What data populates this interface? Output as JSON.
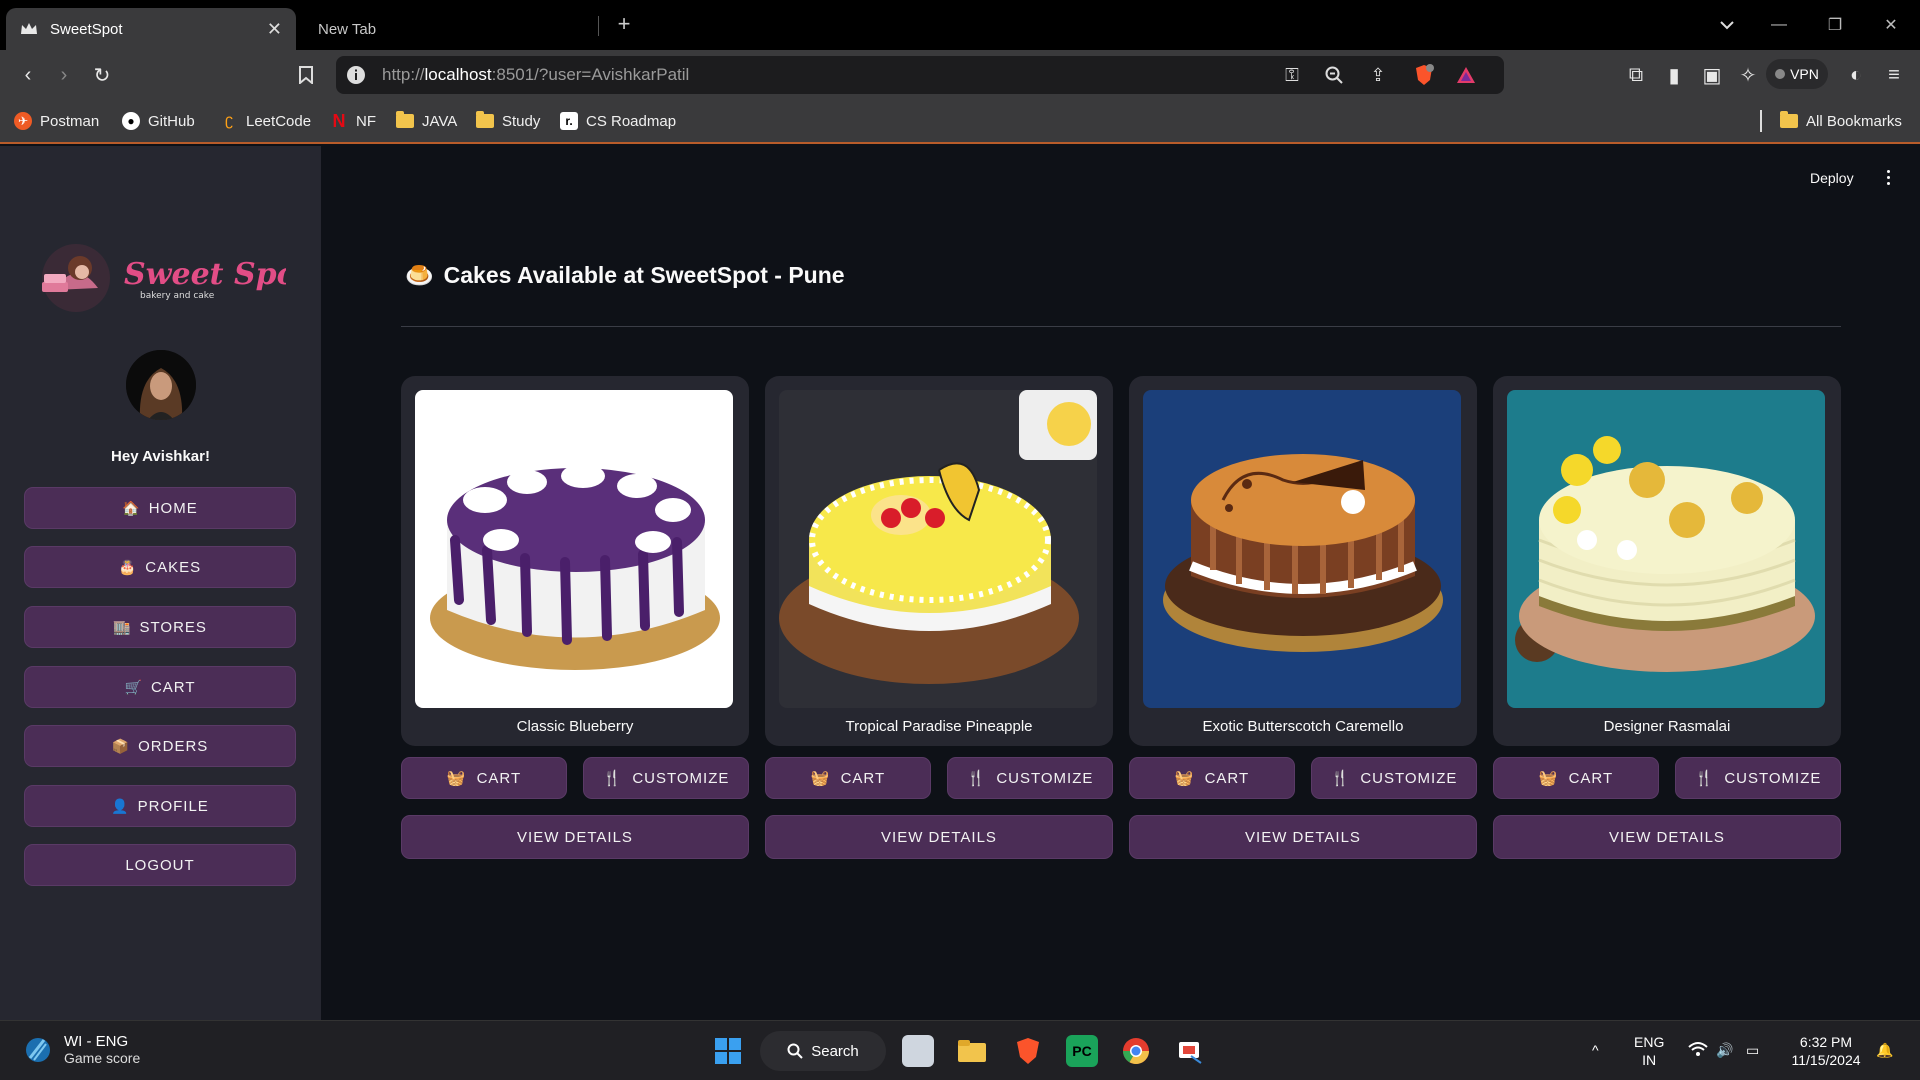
{
  "browser": {
    "active_tab": {
      "title": "SweetSpot"
    },
    "inactive_tab": {
      "title": "New Tab"
    },
    "url_host": "localhost",
    "url_prefix": "http://",
    "url_suffix": ":8501/?user=AvishkarPatil",
    "vpn_label": "VPN",
    "bookmarks": [
      {
        "label": "Postman",
        "icon": "postman-icon"
      },
      {
        "label": "GitHub",
        "icon": "github-icon"
      },
      {
        "label": "LeetCode",
        "icon": "leetcode-icon"
      },
      {
        "label": "NF",
        "icon": "netflix-icon"
      },
      {
        "label": "JAVA",
        "icon": "folder-icon"
      },
      {
        "label": "Study",
        "icon": "folder-icon"
      },
      {
        "label": "CS Roadmap",
        "icon": "roadmap-icon"
      }
    ],
    "all_bookmarks": "All Bookmarks"
  },
  "app": {
    "deploy_label": "Deploy",
    "logo_text": "Sweet Spot",
    "logo_tagline": "bakery and cake",
    "greeting": "Hey Avishkar!",
    "nav": [
      {
        "label": "HOME",
        "icon": "🏠"
      },
      {
        "label": "CAKES",
        "icon": "🎂"
      },
      {
        "label": "STORES",
        "icon": "🏬"
      },
      {
        "label": "CART",
        "icon": "🛒"
      },
      {
        "label": "ORDERS",
        "icon": "📦"
      },
      {
        "label": "PROFILE",
        "icon": "👤"
      },
      {
        "label": "LOGOUT",
        "icon": ""
      }
    ],
    "heading_icon": "🍮",
    "heading": "Cakes Available at SweetSpot - Pune",
    "cart_label": "CART",
    "customize_label": "CUSTOMIZE",
    "view_details_label": "VIEW DETAILS",
    "cakes": [
      {
        "name": "Classic Blueberry"
      },
      {
        "name": "Tropical Paradise Pineapple"
      },
      {
        "name": "Exotic Butterscotch Caremello"
      },
      {
        "name": "Designer Rasmalai"
      }
    ]
  },
  "taskbar": {
    "weather_title": "WI - ENG",
    "weather_sub": "Game score",
    "search_label": "Search",
    "lang_top": "ENG",
    "lang_bottom": "IN",
    "time": "6:32 PM",
    "date": "11/15/2024"
  },
  "colors": {
    "sidebar_bg": "#262730",
    "main_bg": "#0e1117",
    "button_bg": "#4b2d56",
    "accent_border": "#b85c2a"
  }
}
